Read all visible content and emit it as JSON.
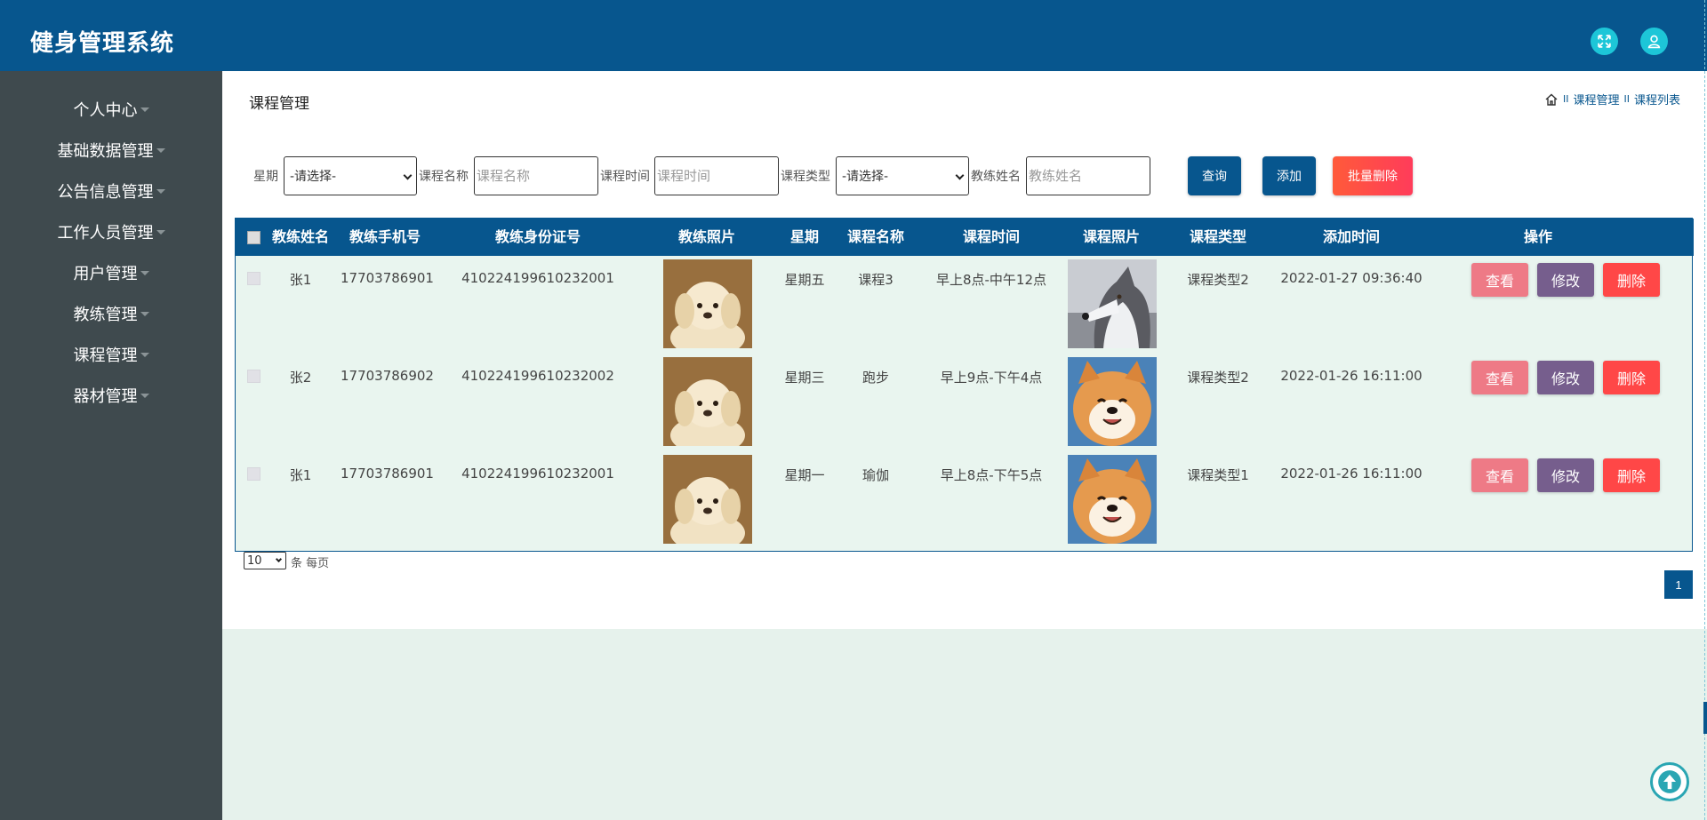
{
  "header": {
    "app_title": "健身管理系统",
    "fullscreen_icon": "expand-icon",
    "user_icon": "user-icon"
  },
  "sidebar": {
    "items": [
      {
        "label": "个人中心"
      },
      {
        "label": "基础数据管理"
      },
      {
        "label": "公告信息管理"
      },
      {
        "label": "工作人员管理"
      },
      {
        "label": "用户管理"
      },
      {
        "label": "教练管理"
      },
      {
        "label": "课程管理"
      },
      {
        "label": "器材管理"
      }
    ]
  },
  "page": {
    "title": "课程管理",
    "breadcrumb": {
      "home_icon": "home-icon",
      "sep": "II",
      "crumb1": "课程管理",
      "crumb2": "课程列表"
    }
  },
  "search": {
    "weekday_label": "星期",
    "weekday_value": "-请选择-",
    "course_name_label": "课程名称",
    "course_name_placeholder": "课程名称",
    "course_time_label": "课程时间",
    "course_time_placeholder": "课程时间",
    "course_type_label": "课程类型",
    "course_type_value": "-请选择-",
    "coach_name_label": "教练姓名",
    "coach_name_placeholder": "教练姓名",
    "query_label": "查询",
    "add_label": "添加",
    "batch_delete_label": "批量删除"
  },
  "table": {
    "columns": [
      "教练姓名",
      "教练手机号",
      "教练身份证号",
      "教练照片",
      "星期",
      "课程名称",
      "课程时间",
      "课程照片",
      "课程类型",
      "添加时间",
      "操作"
    ],
    "rows": [
      {
        "coach_name": "张1",
        "phone": "17703786901",
        "id_card": "410224199610232001",
        "coach_photo": "puppy-photo",
        "weekday": "星期五",
        "course_name": "课程3",
        "course_time": "早上8点-中午12点",
        "course_photo": "husky-photo",
        "course_type": "课程类型2",
        "added": "2022-01-27 09:36:40"
      },
      {
        "coach_name": "张2",
        "phone": "17703786902",
        "id_card": "410224199610232002",
        "coach_photo": "puppy-photo",
        "weekday": "星期三",
        "course_name": "跑步",
        "course_time": "早上9点-下午4点",
        "course_photo": "shiba-photo",
        "course_type": "课程类型2",
        "added": "2022-01-26 16:11:00"
      },
      {
        "coach_name": "张1",
        "phone": "17703786901",
        "id_card": "410224199610232001",
        "coach_photo": "puppy-photo",
        "weekday": "星期一",
        "course_name": "瑜伽",
        "course_time": "早上8点-下午5点",
        "course_photo": "shiba-photo",
        "course_type": "课程类型1",
        "added": "2022-01-26 16:11:00"
      }
    ],
    "actions": {
      "view": "查看",
      "edit": "修改",
      "delete": "删除"
    }
  },
  "pagination": {
    "page_size": "10",
    "per_page_text": "条 每页",
    "current_page": "1"
  },
  "colors": {
    "primary": "#07568e",
    "sidebar": "#3f4a4e",
    "accent_cyan": "#1dc6d8",
    "batch_delete": "#ff4a45",
    "view": "#ee7a86",
    "edit": "#765e8d",
    "delete": "#ff4747"
  },
  "back_to_top_icon": "arrow-up-icon"
}
